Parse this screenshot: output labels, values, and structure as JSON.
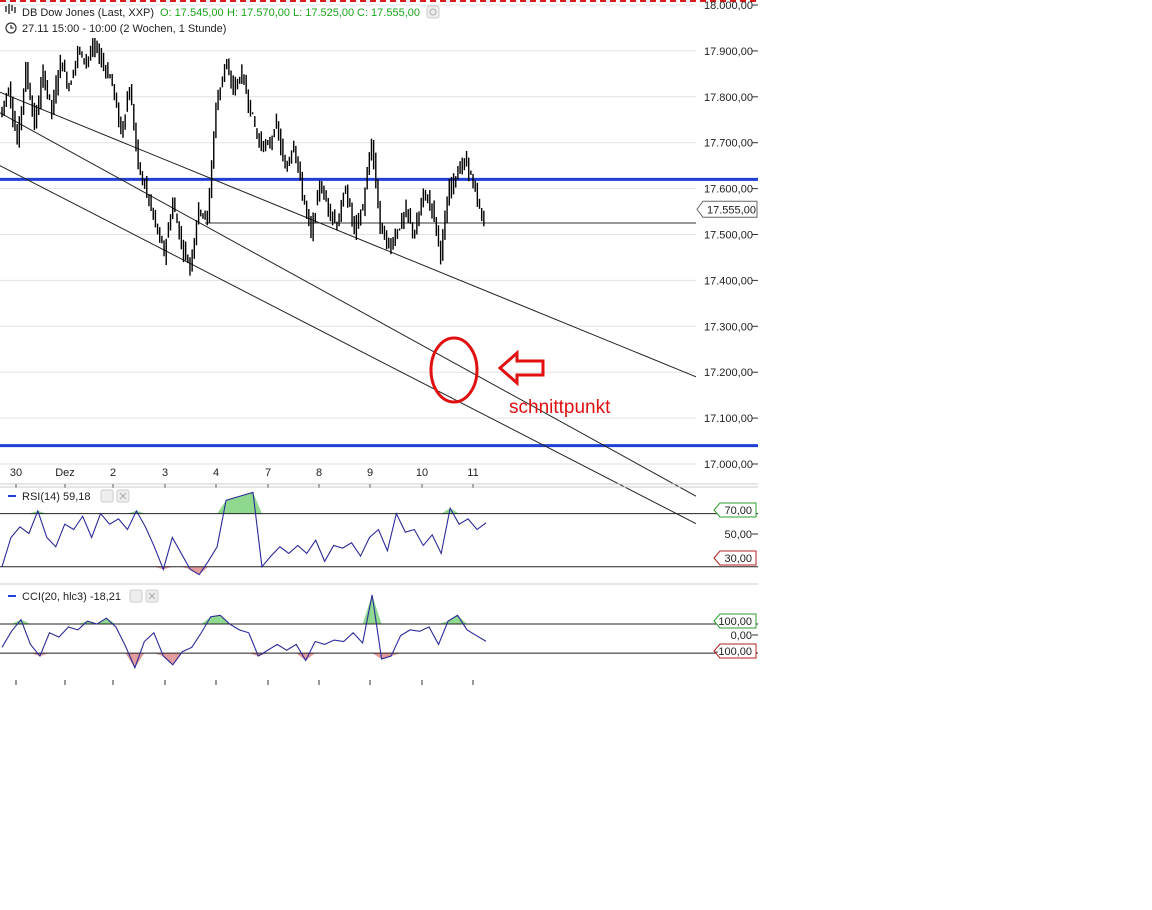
{
  "colors": {
    "bar": "#000000",
    "grid": "#e2e2e2",
    "hline": "#1f3fd6",
    "last_label_border": "#666666",
    "rsi_line": "#2a2a9a",
    "osc_above": "#8fd98f",
    "osc_below": "#e39a9a",
    "up_border": "#2e9e2e",
    "down_border": "#b02020",
    "annotation": "#e01010",
    "top_dash": "#d81b1b",
    "ohlc_value": "#1aa51a"
  },
  "header": {
    "symbol": "DB Dow Jones (Last, XXP)",
    "o": "O: 17.545,00",
    "h": "H: 17.570,00",
    "l": "L: 17.525,00",
    "c": "C: 17.555,00",
    "range": "27.11 15:00 - 10:00 (2 Wochen, 1 Stunde)",
    "icon_chart": "bar-chart-icon",
    "icon_clock": "clock-icon",
    "icon_settings": "settings-icon"
  },
  "annotation": {
    "text": "schnittpunkt",
    "icon_arrow": "left-arrow-icon",
    "icon_circle": "circle-marker-icon"
  },
  "chart_data": [
    {
      "type": "line",
      "title": "DB Dow Jones (Last, XXP)",
      "ylim": [
        16950,
        18000
      ],
      "y_ticks": [
        "18.000,00",
        "17.900,00",
        "17.800,00",
        "17.700,00",
        "17.600,00",
        "17.500,00",
        "17.400,00",
        "17.300,00",
        "17.200,00",
        "17.100,00",
        "17.000,00"
      ],
      "x_ticks": [
        "30",
        "Dez",
        "2",
        "3",
        "4",
        "7",
        "8",
        "9",
        "10",
        "11"
      ],
      "last_value": 17555,
      "last_label": "17.555,00",
      "horizontal_lines": [
        17620,
        17040
      ],
      "price_line": 17525,
      "trendlines": [
        {
          "from": [
            0,
            17810
          ],
          "to": [
            1,
            17190
          ]
        },
        {
          "from": [
            0,
            17765
          ],
          "to": [
            1,
            16930
          ]
        },
        {
          "from": [
            0,
            17650
          ],
          "to": [
            1,
            16870
          ]
        }
      ],
      "price_path": [
        17760,
        17820,
        17700,
        17860,
        17740,
        17850,
        17770,
        17880,
        17820,
        17900,
        17880,
        17910,
        17870,
        17830,
        17720,
        17820,
        17650,
        17590,
        17520,
        17460,
        17570,
        17480,
        17430,
        17560,
        17530,
        17780,
        17870,
        17820,
        17850,
        17770,
        17700,
        17690,
        17740,
        17640,
        17700,
        17590,
        17500,
        17610,
        17560,
        17520,
        17600,
        17510,
        17560,
        17700,
        17520,
        17470,
        17510,
        17550,
        17500,
        17590,
        17560,
        17460,
        17600,
        17640,
        17660,
        17590,
        17520
      ],
      "grid": true
    },
    {
      "type": "line",
      "title": "RSI(14) 59,18",
      "series": [
        {
          "name": "RSI(14)",
          "values": [
            30,
            52,
            60,
            55,
            72,
            52,
            45,
            62,
            58,
            68,
            52,
            70,
            62,
            66,
            58,
            72,
            60,
            45,
            28,
            52,
            40,
            28,
            24,
            34,
            45,
            80,
            82,
            84,
            86,
            30,
            38,
            45,
            40,
            46,
            40,
            50,
            34,
            46,
            44,
            48,
            38,
            52,
            58,
            42,
            70,
            56,
            58,
            46,
            54,
            40,
            74,
            62,
            66,
            58,
            63
          ]
        }
      ],
      "ylim": [
        20,
        90
      ],
      "levels": [
        70,
        50,
        30
      ],
      "level_labels": [
        "70,00",
        "50,00",
        "30,00"
      ]
    },
    {
      "type": "line",
      "title": "CCI(20, hlc3) -18,21",
      "series": [
        {
          "name": "CCI(20, hlc3)",
          "values": [
            -60,
            50,
            130,
            -40,
            -120,
            40,
            10,
            80,
            60,
            120,
            100,
            140,
            80,
            -50,
            -200,
            -20,
            40,
            -120,
            -180,
            -90,
            -60,
            40,
            150,
            160,
            100,
            60,
            40,
            -120,
            -80,
            -40,
            -80,
            -40,
            -150,
            -20,
            -40,
            -10,
            -20,
            40,
            -30,
            300,
            -140,
            -120,
            20,
            60,
            50,
            80,
            -40,
            120,
            160,
            60,
            20,
            -18
          ]
        }
      ],
      "ylim": [
        -250,
        320
      ],
      "levels": [
        100,
        0,
        -100
      ],
      "level_labels": [
        "100,00",
        "0,00",
        "-100,00"
      ]
    }
  ]
}
